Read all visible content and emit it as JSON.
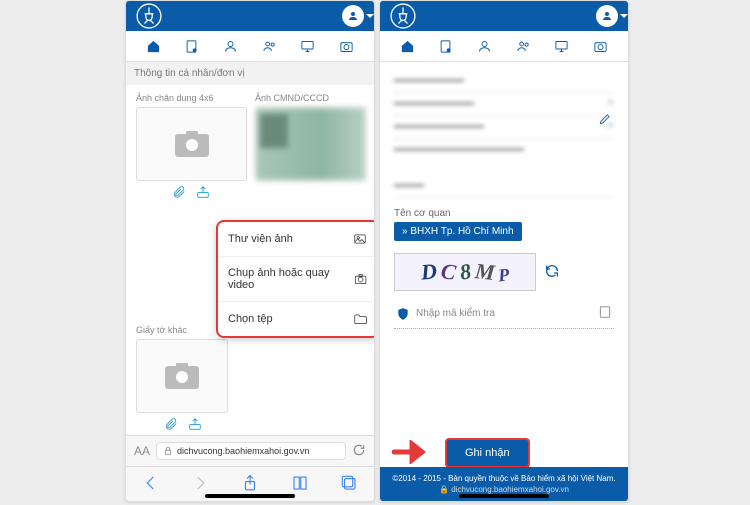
{
  "left": {
    "section_title": "Thông tin cá nhân/đơn vị",
    "portrait_label": "Ảnh chân dung 4x6",
    "id_label": "Ảnh CMND/CCCD",
    "other_label": "Giấy tờ khác",
    "menu": {
      "gallery": "Thư viện ảnh",
      "capture": "Chụp ảnh hoặc quay video",
      "file": "Chọn tệp"
    },
    "url": "dichvucong.baohiemxahoi.gov.vn"
  },
  "right": {
    "org_label": "Tên cơ quan",
    "org_value": "BHXH Tp. Hồ Chí Minh",
    "captcha": [
      "D",
      "C",
      "8",
      "M",
      "P"
    ],
    "captcha_placeholder": "Nhập mã kiểm tra",
    "submit": "Ghi nhận",
    "footer_text": "©2014 - 2015 - Bản quyền thuộc về Bảo hiểm xã hội Việt Nam.",
    "footer_url": "dichvucong.baohiemxahoi.gov.vn"
  }
}
